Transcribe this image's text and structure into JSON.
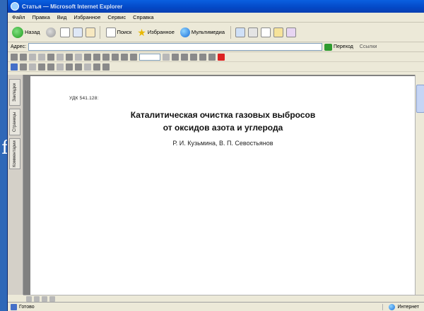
{
  "window": {
    "title": "Статья — Microsoft Internet Explorer"
  },
  "menu": [
    "Файл",
    "Правка",
    "Вид",
    "Избранное",
    "Сервис",
    "Справка"
  ],
  "toolbar": {
    "back": "Назад",
    "search": "Поиск",
    "favorites": "Избранное",
    "media": "Мультимедиа"
  },
  "address": {
    "label": "Адрес:",
    "value": "",
    "go": "Переход",
    "links": "Ссылки"
  },
  "pdf": {
    "zoom": ""
  },
  "nav_tabs": [
    "Закладки",
    "Страницы",
    "Комментарии"
  ],
  "document": {
    "udk": "УДК 541.128:",
    "title_line1": "Каталитическая очистка газовых выбросов",
    "title_line2": "от оксидов азота и углерода",
    "authors": "Р. И. Кузьмина, В. П. Севостьянов",
    "p1": "",
    "p2": "",
    "p3": "",
    "col_left": "",
    "col_right": ""
  },
  "status": {
    "left": "Готово",
    "zone": "Интернет"
  }
}
